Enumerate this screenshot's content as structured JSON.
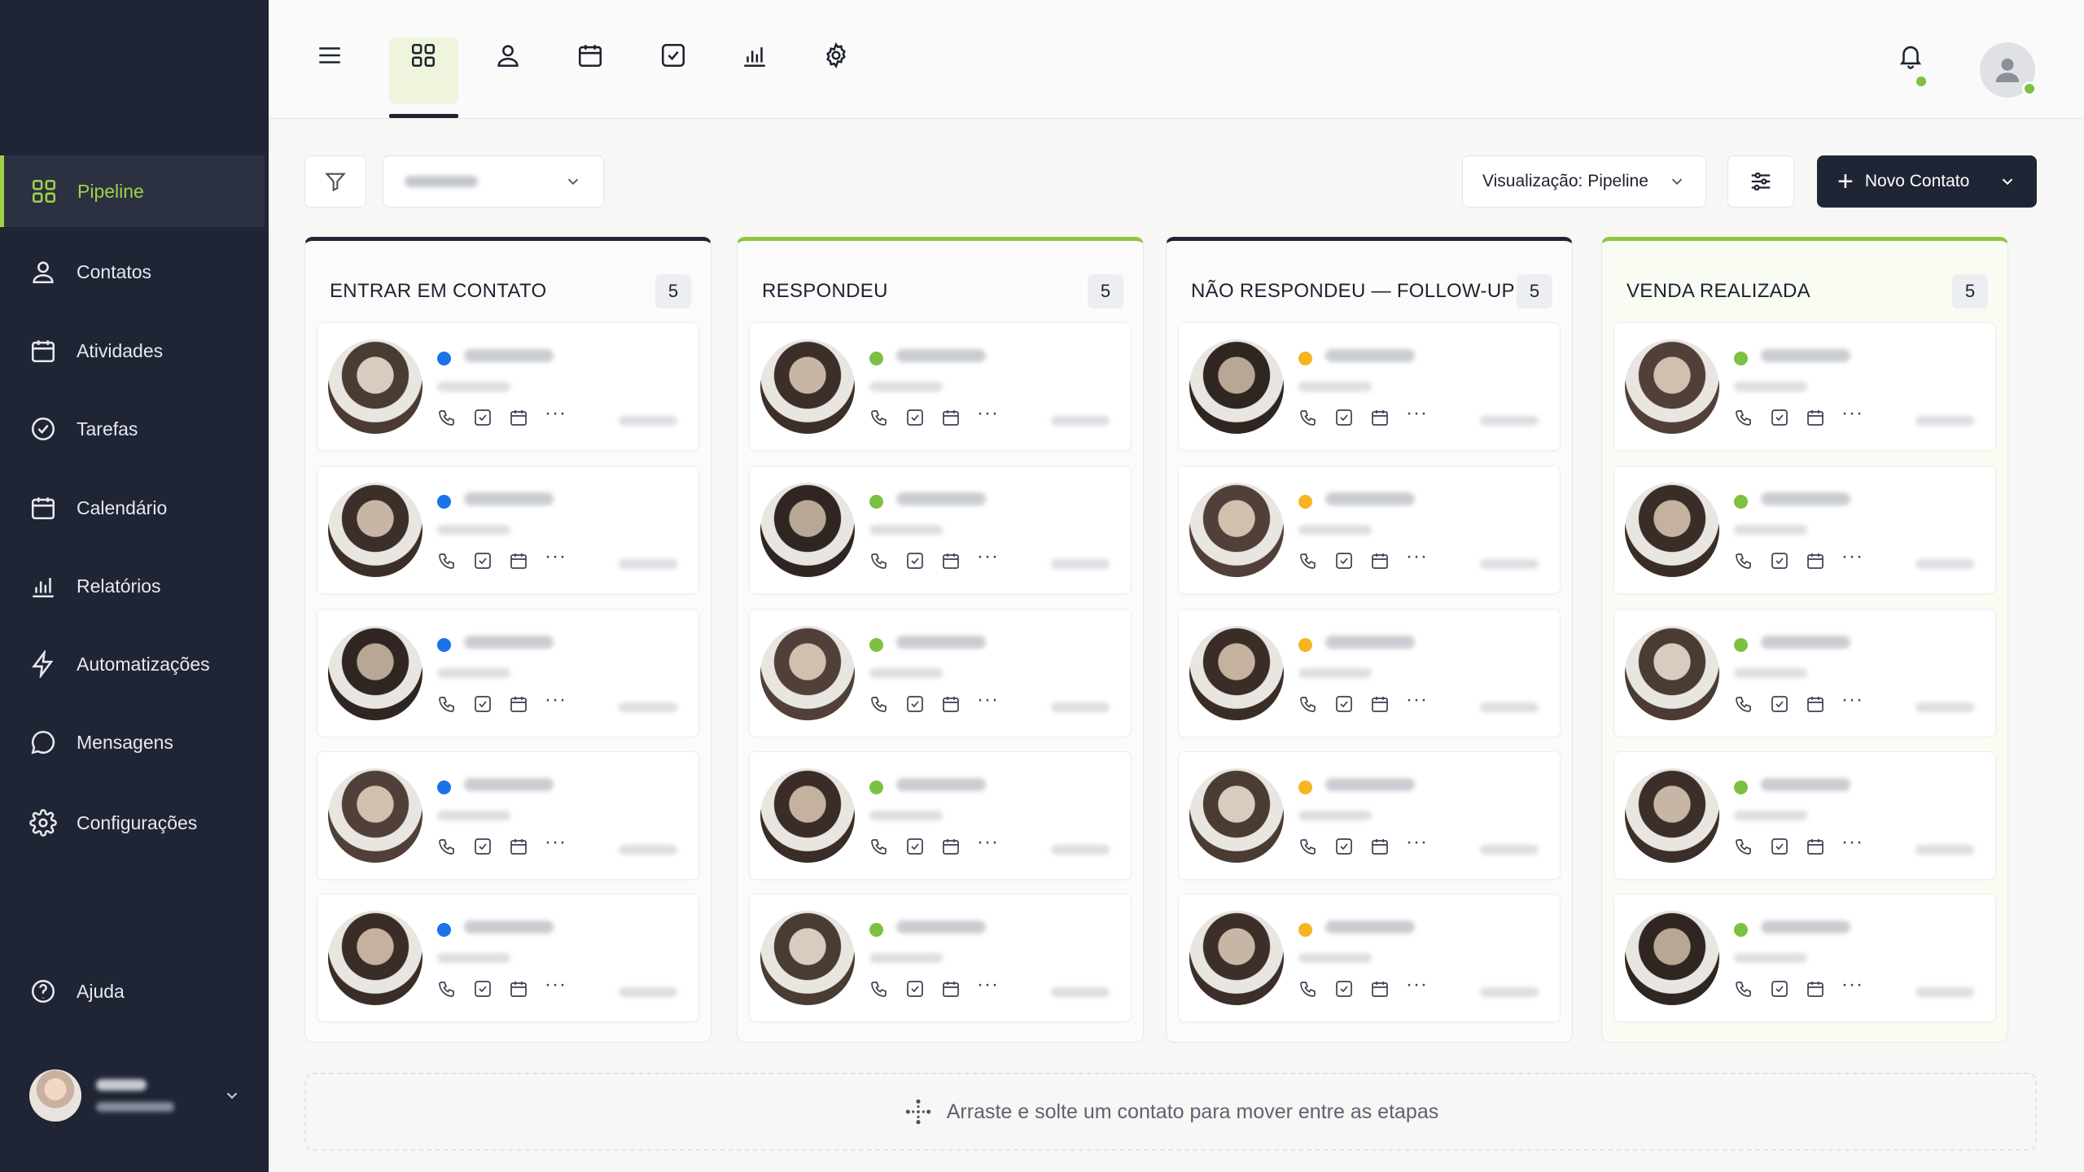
{
  "colors": {
    "sidebar_bg": "#1f2534",
    "accent_green": "#9fd14a",
    "status_blue": "#1a73e8",
    "status_green": "#7cc142",
    "status_yellow": "#f6b51e"
  },
  "sidebar": {
    "items": [
      {
        "label": "Pipeline",
        "icon": "grid-icon"
      },
      {
        "label": "Contatos",
        "icon": "user-icon"
      },
      {
        "label": "Atividades",
        "icon": "calendar-icon"
      },
      {
        "label": "Tarefas",
        "icon": "check-circle-icon"
      },
      {
        "label": "Calendário",
        "icon": "calendar-icon"
      },
      {
        "label": "Relatórios",
        "icon": "bar-chart-icon"
      },
      {
        "label": "Automatizações",
        "icon": "bolt-icon"
      },
      {
        "label": "Mensagens",
        "icon": "chat-icon"
      },
      {
        "label": "Configurações",
        "icon": "gear-icon"
      }
    ],
    "help_label": "Ajuda"
  },
  "toolbar": {
    "view_label": "Visualização: Pipeline",
    "new_contact_label": "Novo Contato"
  },
  "columns": [
    {
      "title": "ENTRAR EM CONTATO",
      "count": "5",
      "status_color": "#1a73e8"
    },
    {
      "title": "RESPONDEU",
      "count": "5",
      "status_color": "#7cc142"
    },
    {
      "title": "NÃO RESPONDEU — FOLLOW-UP",
      "count": "5",
      "status_color": "#f6b51e"
    },
    {
      "title": "VENDA REALIZADA",
      "count": "5",
      "status_color": "#7cc142"
    }
  ],
  "hint_text": "Arraste e solte um contato para mover entre as etapas"
}
